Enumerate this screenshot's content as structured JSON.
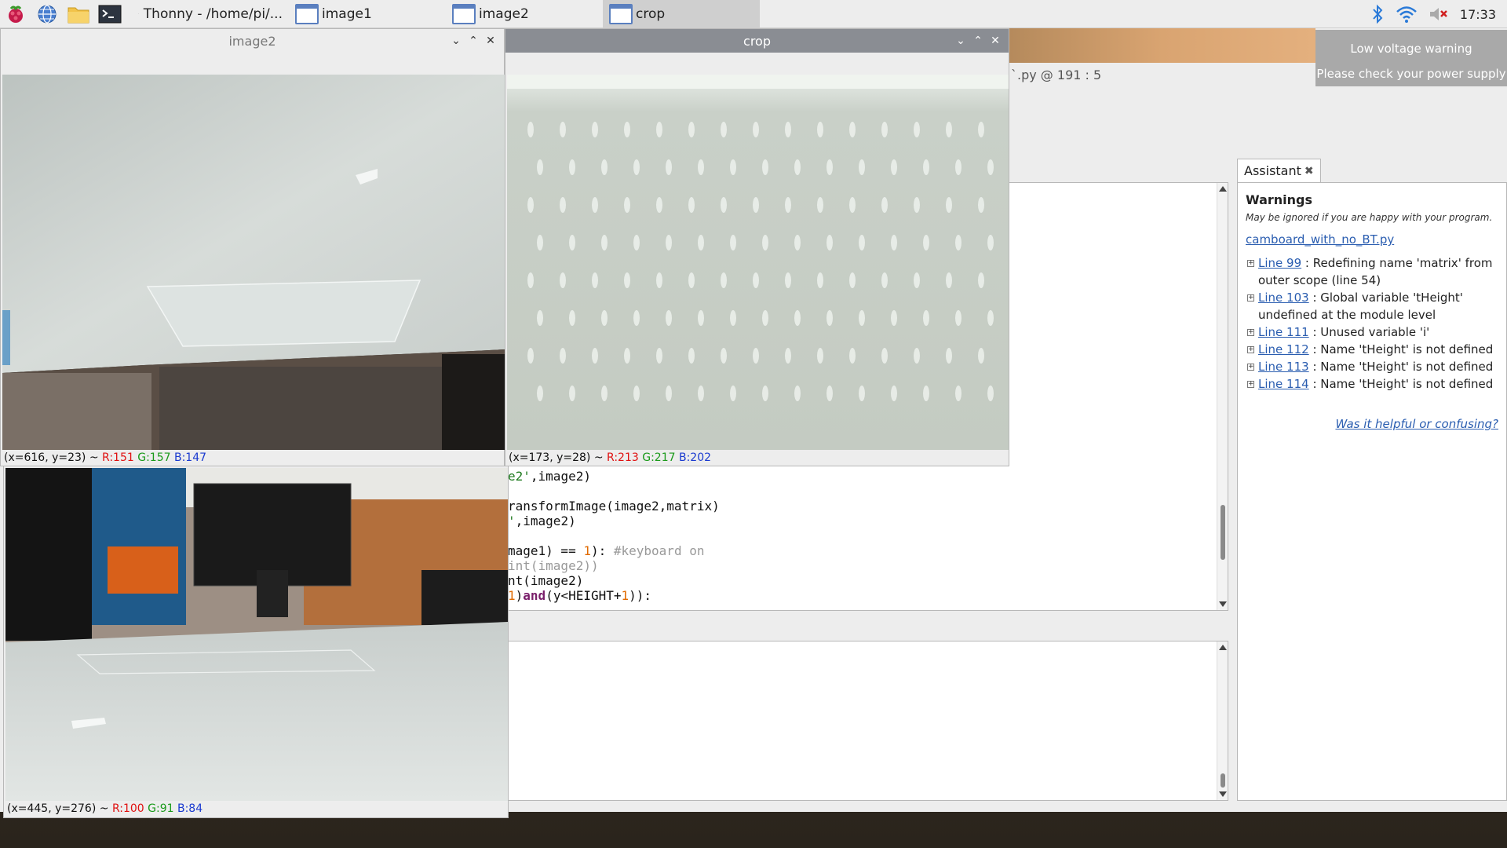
{
  "taskbar": {
    "tasks": [
      {
        "label": "Thonny  -  /home/pi/..."
      },
      {
        "label": "image1"
      },
      {
        "label": "image2"
      },
      {
        "label": "crop"
      }
    ],
    "clock": "17:33"
  },
  "notification": {
    "title": "Low voltage warning",
    "message": "Please check your power supply"
  },
  "thonny": {
    "cursor_status": "`.py  @  191 : 5",
    "colon_mark": ":",
    "code_lines": [
      "e2',image2)",
      "",
      "ransformImage(image2,matrix)",
      "',image2)",
      "",
      "mage1) == 1): #keyboard on",
      "int(image2))",
      "nt(image2)",
      "1)and(y<HEIGHT+1)):"
    ]
  },
  "assistant": {
    "tab_label": "Assistant",
    "heading": "Warnings",
    "subtitle": "May be ignored if you are happy with your program.",
    "file_link": "camboard_with_no_BT.py",
    "warnings": [
      {
        "line": "Line 99",
        "text": " : Redefining name 'matrix' from outer scope (line 54)"
      },
      {
        "line": "Line 103",
        "text": " : Global variable 'tHeight' undefined at the module level"
      },
      {
        "line": "Line 111",
        "text": " : Unused variable 'i'"
      },
      {
        "line": "Line 112",
        "text": " : Name 'tHeight' is not defined"
      },
      {
        "line": "Line 113",
        "text": " : Name 'tHeight' is not defined"
      },
      {
        "line": "Line 114",
        "text": " : Name 'tHeight' is not defined"
      }
    ],
    "helpful_link": "Was it helpful or confusing?"
  },
  "windows": {
    "image2": {
      "title": "image2",
      "status": {
        "pos": "(x=616, y=23) ~ ",
        "r": "R:151",
        "g": "G:157",
        "b": "B:147"
      }
    },
    "crop": {
      "title": "crop",
      "status": {
        "pos": "(x=173, y=28) ~ ",
        "r": "R:213",
        "g": "G:217",
        "b": "B:202"
      }
    },
    "image1": {
      "status": {
        "pos": "(x=445, y=276) ~ ",
        "r": "R:100",
        "g": "G:91",
        "b": "B:84"
      }
    }
  }
}
